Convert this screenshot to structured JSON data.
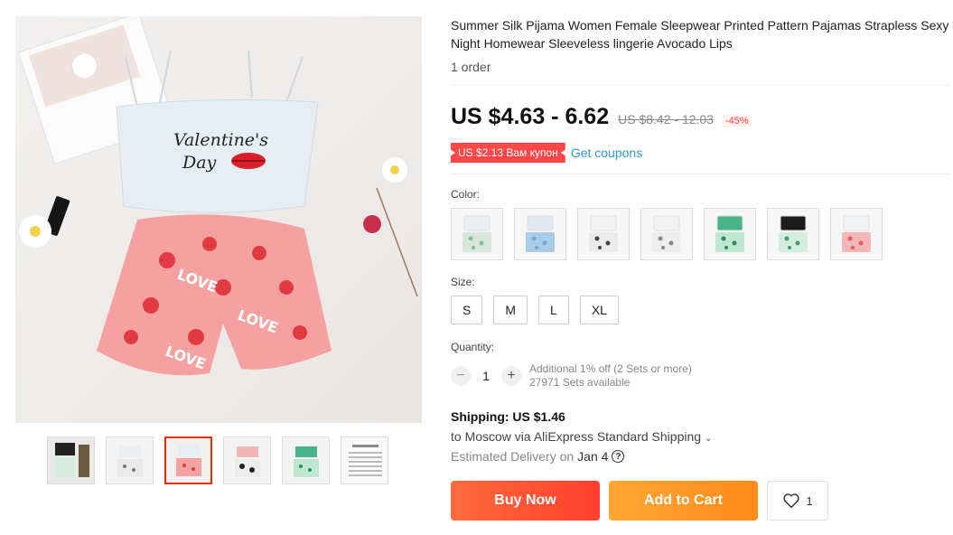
{
  "product": {
    "title": "Summer Silk Pijama Women Female Sleepwear Printed Pattern Pajamas Strapless Sexy Night Homewear Sleeveless lingerie Avocado Lips",
    "orders": "1 order"
  },
  "price": {
    "current": "US $4.63 - 6.62",
    "original": "US $8.42 - 12.03",
    "discount": "-45%"
  },
  "coupon": {
    "badge": "US $2.13 Вам купон",
    "link": "Get coupons"
  },
  "options": {
    "color_label": "Color:",
    "colors": [
      {
        "top": "#e8eef2",
        "bottom": "#d9e6dc",
        "accent": "#7fbf8f"
      },
      {
        "top": "#dfe9f2",
        "bottom": "#a9cde8",
        "accent": "#6ea8d6"
      },
      {
        "top": "#f3f3f3",
        "bottom": "#ebebeb",
        "accent": "#444444"
      },
      {
        "top": "#f2f2f2",
        "bottom": "#eeeeee",
        "accent": "#8a8a8a"
      },
      {
        "top": "#48b48a",
        "bottom": "#bfe6cf",
        "accent": "#2a8a62"
      },
      {
        "top": "#1b1b1b",
        "bottom": "#d5ecde",
        "accent": "#3aa071"
      },
      {
        "top": "#f1f3f5",
        "bottom": "#f4b7b8",
        "accent": "#e25a5a"
      }
    ],
    "size_label": "Size:",
    "sizes": [
      "S",
      "M",
      "L",
      "XL"
    ]
  },
  "quantity": {
    "label": "Quantity:",
    "value": "1",
    "minus": "−",
    "plus": "+",
    "note_line1": "Additional 1% off (2 Sets or more)",
    "note_line2": "27971 Sets available"
  },
  "shipping": {
    "title": "Shipping: US $1.46",
    "to_prefix": "to Moscow via AliExpress Standard Shipping",
    "est_prefix": "Estimated Delivery on",
    "est_date": "Jan 4",
    "help": "?"
  },
  "actions": {
    "buy": "Buy Now",
    "cart": "Add to Cart",
    "wish_count": "1"
  },
  "image": {
    "shirt_text_line1": "Valentine's",
    "shirt_text_line2": "Day",
    "shorts_text": "LOVE"
  },
  "colors": {
    "accent_red": "#ff4747",
    "link_blue": "#2e9cc3",
    "buy_orange": "#ff4a30",
    "cart_orange": "#ff9a24"
  }
}
